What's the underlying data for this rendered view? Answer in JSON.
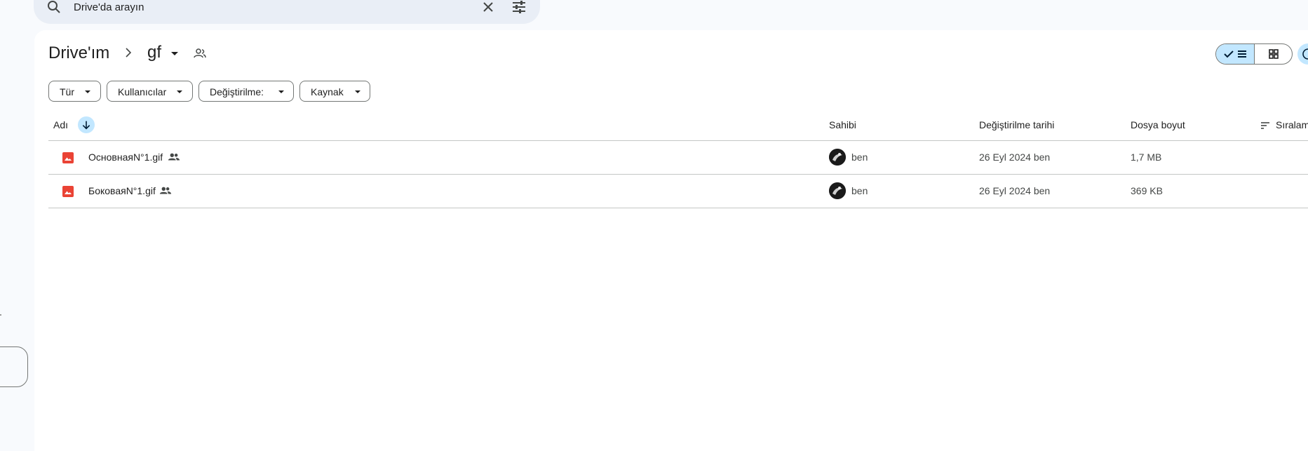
{
  "search": {
    "placeholder": "Drive'da arayın"
  },
  "breadcrumb": {
    "root": "Drive'ım",
    "current": "gf"
  },
  "filters": [
    "Tür",
    "Kullanıcılar",
    "Değiştirilme:",
    "Kaynak"
  ],
  "view": {
    "active": "list"
  },
  "table": {
    "headers": {
      "name": "Adı",
      "owner": "Sahibi",
      "modified": "Değiştirilme tarihi",
      "size": "Dosya boyut",
      "sort": "Sıralam"
    },
    "rows": [
      {
        "name": "ОсновнаяN°1.gif",
        "owner": "ben",
        "modified": "26 Eyl 2024 ben",
        "size": "1,7 MB",
        "shared": true
      },
      {
        "name": "БоковаяN°1.gif",
        "owner": "ben",
        "modified": "26 Eyl 2024 ben",
        "size": "369 KB",
        "shared": true
      }
    ]
  },
  "colors": {
    "accent": "#c2e7ff",
    "file_icon": "#ea4335",
    "surface": "#f8fafd"
  },
  "icons": {
    "search": "search-icon",
    "clear": "close-icon",
    "tune": "tune-icon",
    "chevron": "chevron-right-icon",
    "caret": "caret-down-icon",
    "shared": "people-icon",
    "check": "check-icon",
    "list": "list-icon",
    "grid": "grid-icon",
    "sort_arrow": "arrow-down-icon",
    "sort_lines": "sort-icon",
    "image": "image-file-icon"
  }
}
